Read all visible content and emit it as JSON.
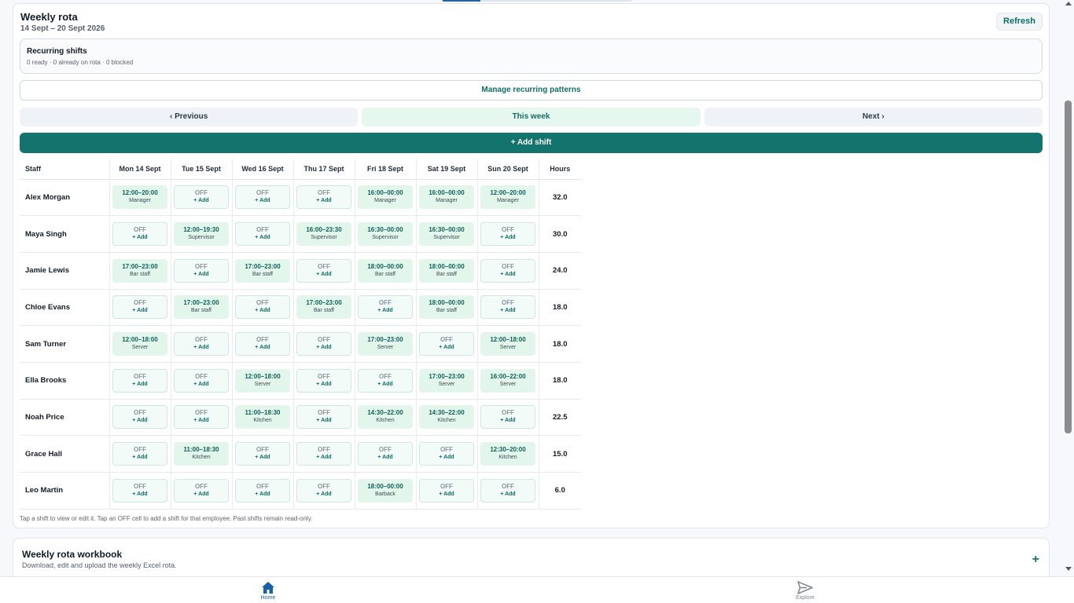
{
  "header": {
    "title": "Weekly rota",
    "subtitle": "14 Sept – 20 Sept 2026",
    "refresh_label": "Refresh"
  },
  "recurring": {
    "title": "Recurring shifts",
    "status": "0 ready · 0 already on rota · 0 blocked"
  },
  "manage_label": "Manage recurring patterns",
  "nav": {
    "prev_label": "‹ Previous",
    "this_label": "This week",
    "next_label": "Next ›"
  },
  "add_shift_label": "+ Add shift",
  "table": {
    "headers": {
      "staff": "Staff",
      "hours": "Hours",
      "days": [
        "Mon 14 Sept",
        "Tue 15 Sept",
        "Wed 16 Sept",
        "Thu 17 Sept",
        "Fri 18 Sept",
        "Sat 19 Sept",
        "Sun 20 Sept"
      ]
    },
    "off_label": "OFF",
    "add_label": "+ Add",
    "rows": [
      {
        "name": "Alex Morgan",
        "hours": "32.0",
        "cells": [
          {
            "time": "12:00–20:00",
            "role": "Manager"
          },
          null,
          null,
          null,
          {
            "time": "16:00–00:00",
            "role": "Manager"
          },
          {
            "time": "16:00–00:00",
            "role": "Manager"
          },
          {
            "time": "12:00–20:00",
            "role": "Manager"
          }
        ]
      },
      {
        "name": "Maya Singh",
        "hours": "30.0",
        "cells": [
          null,
          {
            "time": "12:00–19:30",
            "role": "Supervisor"
          },
          null,
          {
            "time": "16:00–23:30",
            "role": "Supervisor"
          },
          {
            "time": "16:30–00:00",
            "role": "Supervisor"
          },
          {
            "time": "16:30–00:00",
            "role": "Supervisor"
          },
          null
        ]
      },
      {
        "name": "Jamie Lewis",
        "hours": "24.0",
        "cells": [
          {
            "time": "17:00–23:00",
            "role": "Bar staff"
          },
          null,
          {
            "time": "17:00–23:00",
            "role": "Bar staff"
          },
          null,
          {
            "time": "18:00–00:00",
            "role": "Bar staff"
          },
          {
            "time": "18:00–00:00",
            "role": "Bar staff"
          },
          null
        ]
      },
      {
        "name": "Chloe Evans",
        "hours": "18.0",
        "cells": [
          null,
          {
            "time": "17:00–23:00",
            "role": "Bar staff"
          },
          null,
          {
            "time": "17:00–23:00",
            "role": "Bar staff"
          },
          null,
          {
            "time": "18:00–00:00",
            "role": "Bar staff"
          },
          null
        ]
      },
      {
        "name": "Sam Turner",
        "hours": "18.0",
        "cells": [
          {
            "time": "12:00–18:00",
            "role": "Server"
          },
          null,
          null,
          null,
          {
            "time": "17:00–23:00",
            "role": "Server"
          },
          null,
          {
            "time": "12:00–18:00",
            "role": "Server"
          }
        ]
      },
      {
        "name": "Ella Brooks",
        "hours": "18.0",
        "cells": [
          null,
          null,
          {
            "time": "12:00–18:00",
            "role": "Server"
          },
          null,
          null,
          {
            "time": "17:00–23:00",
            "role": "Server"
          },
          {
            "time": "16:00–22:00",
            "role": "Server"
          }
        ]
      },
      {
        "name": "Noah Price",
        "hours": "22.5",
        "cells": [
          null,
          null,
          {
            "time": "11:00–18:30",
            "role": "Kitchen"
          },
          null,
          {
            "time": "14:30–22:00",
            "role": "Kitchen"
          },
          {
            "time": "14:30–22:00",
            "role": "Kitchen"
          },
          null
        ]
      },
      {
        "name": "Grace Hall",
        "hours": "15.0",
        "cells": [
          null,
          {
            "time": "11:00–18:30",
            "role": "Kitchen"
          },
          null,
          null,
          null,
          null,
          {
            "time": "12:30–20:00",
            "role": "Kitchen"
          }
        ]
      },
      {
        "name": "Leo Martin",
        "hours": "6.0",
        "cells": [
          null,
          null,
          null,
          null,
          {
            "time": "18:00–00:00",
            "role": "Barback"
          },
          null,
          null
        ]
      }
    ]
  },
  "help_text": "Tap a shift to view or edit it. Tap an OFF cell to add a shift for that employee. Past shifts remain read-only.",
  "workbook": {
    "title": "Weekly rota workbook",
    "subtitle": "Download, edit and upload the weekly Excel rota.",
    "toggle": "+"
  },
  "bottom_nav": {
    "home_label": "Home",
    "explore_label": "Explore"
  },
  "colors": {
    "accent": "#12746c",
    "shift_bg": "#e3f6ec",
    "off_border": "#cfe7e0",
    "home_active": "#1a5fa8"
  },
  "icons": {
    "home": "home-icon",
    "explore": "send-icon"
  }
}
